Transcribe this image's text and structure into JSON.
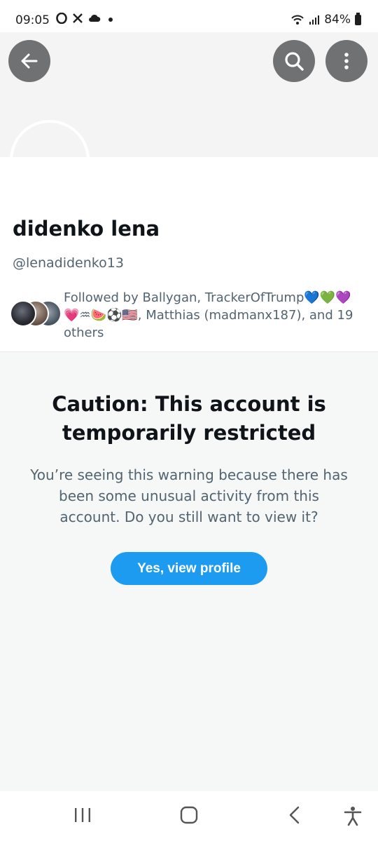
{
  "status_bar": {
    "time": "09:05",
    "left_icons": [
      "opera-icon",
      "x-logo-icon",
      "cloud-icon",
      "dot-icon"
    ],
    "battery": "84%"
  },
  "header": {
    "back_icon": "arrow-left-icon",
    "search_icon": "search-icon",
    "more_icon": "more-vertical-icon"
  },
  "profile": {
    "display_name": "didenko lena",
    "handle": "@lenadidenko13",
    "followed_by": "Followed by Ballygan, TrackerOfTrump💙💚💜💗♒🍉⚽🇺🇸, Matthias (madmanx187), and 19 others"
  },
  "restriction": {
    "title": "Caution: This account is temporarily restricted",
    "message": "You’re seeing this warning because there has been some unusual activity from this account. Do you still want to view it?",
    "button_label": "Yes, view profile"
  },
  "colors": {
    "accent": "#1d9bf0",
    "secondary_text": "#536471",
    "banner": "#f4f4f4",
    "restricted_bg": "#f6f7f7"
  },
  "nav_bar": {
    "icons": [
      "recents-icon",
      "home-icon",
      "back-icon",
      "accessibility-icon"
    ]
  }
}
